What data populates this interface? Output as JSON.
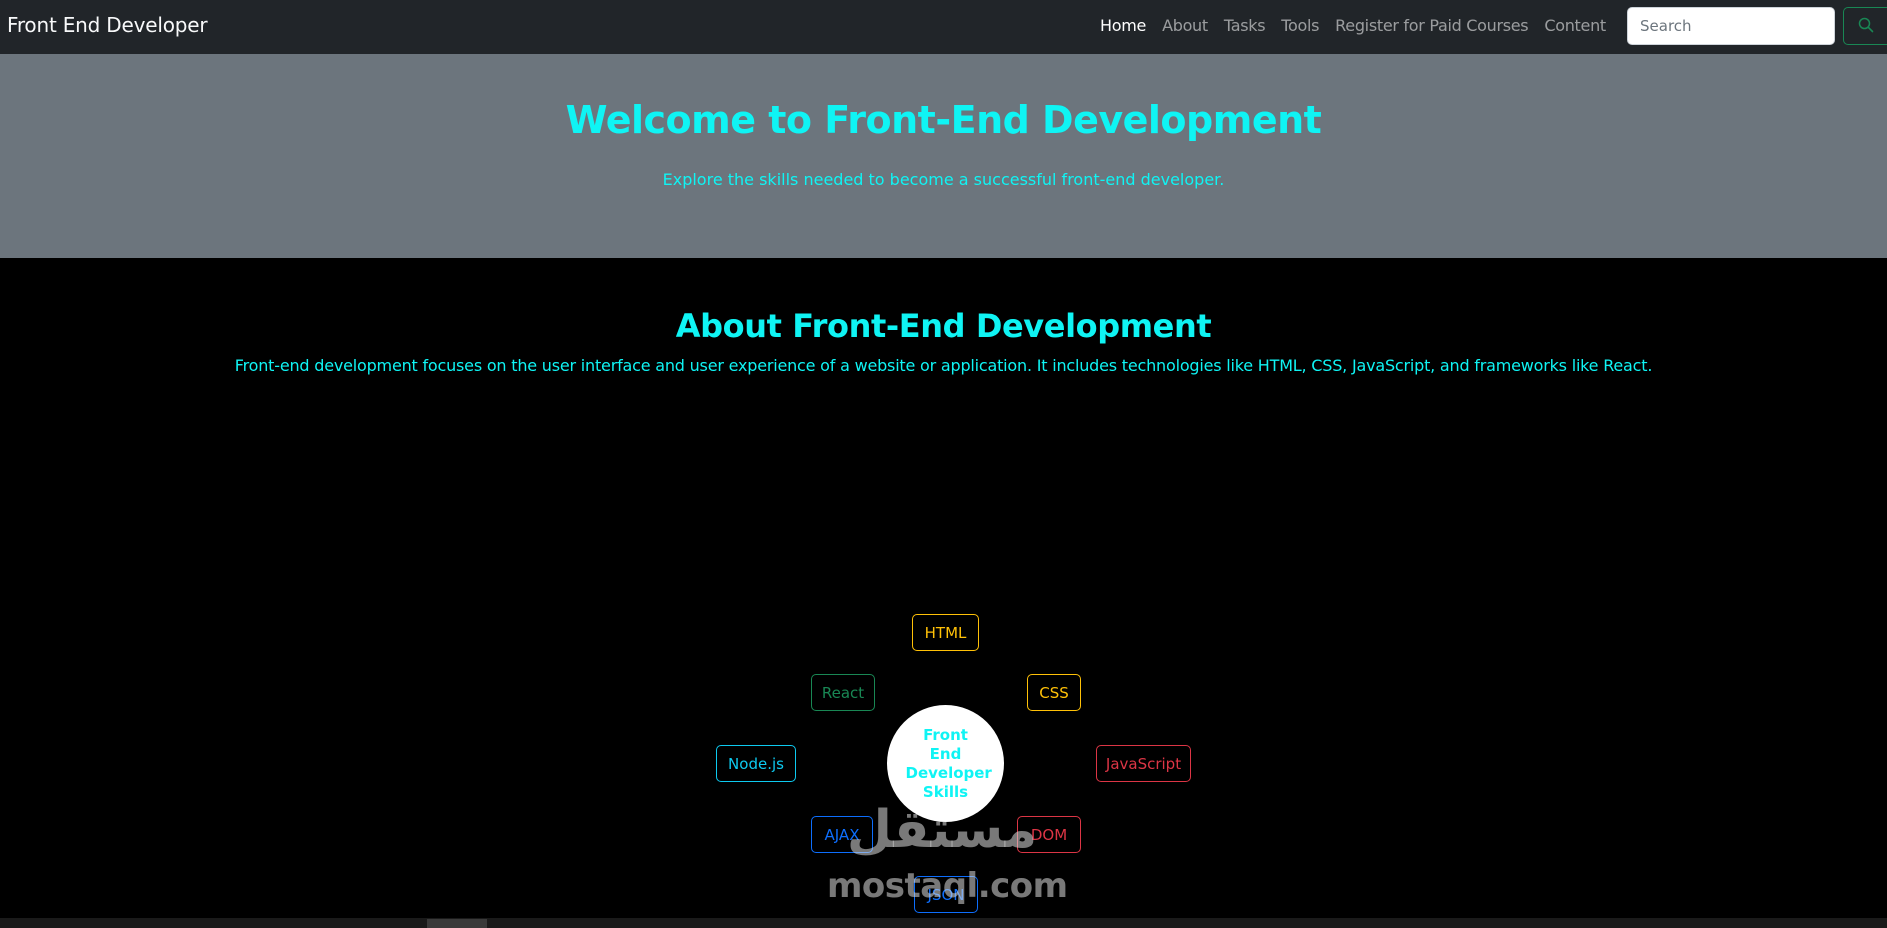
{
  "navbar": {
    "brand": "Front End Developer",
    "links": [
      {
        "label": "Home",
        "active": true
      },
      {
        "label": "About",
        "active": false
      },
      {
        "label": "Tasks",
        "active": false
      },
      {
        "label": "Tools",
        "active": false
      },
      {
        "label": "Register for Paid Courses",
        "active": false
      },
      {
        "label": "Content",
        "active": false
      }
    ],
    "search_placeholder": "Search",
    "search_icon": "search-icon"
  },
  "hero": {
    "title": "Welcome to Front-End Development",
    "subtitle": "Explore the skills needed to become a successful front-end developer."
  },
  "about": {
    "title": "About Front-End Development",
    "text": "Front-end development focuses on the user interface and user experience of a website or application. It includes technologies like HTML, CSS, JavaScript, and frameworks like React."
  },
  "skills": {
    "center": "Front End Developer Skills",
    "items": [
      {
        "label": "HTML",
        "color": "#ffc107"
      },
      {
        "label": "CSS",
        "color": "#ffc107"
      },
      {
        "label": "JavaScript",
        "color": "#dc3545"
      },
      {
        "label": "DOM",
        "color": "#dc3545"
      },
      {
        "label": "JSON",
        "color": "#0d6efd"
      },
      {
        "label": "AJAX",
        "color": "#0d6efd"
      },
      {
        "label": "Node.js",
        "color": "#0dcaf0"
      },
      {
        "label": "React",
        "color": "#198754"
      }
    ]
  },
  "watermark": {
    "arabic": "مستقل",
    "latin": "mostaql.com"
  },
  "colors": {
    "accent": "#0ff4f4",
    "navbar_bg": "#212529",
    "hero_bg": "#6c757d",
    "page_bg": "#000000"
  }
}
